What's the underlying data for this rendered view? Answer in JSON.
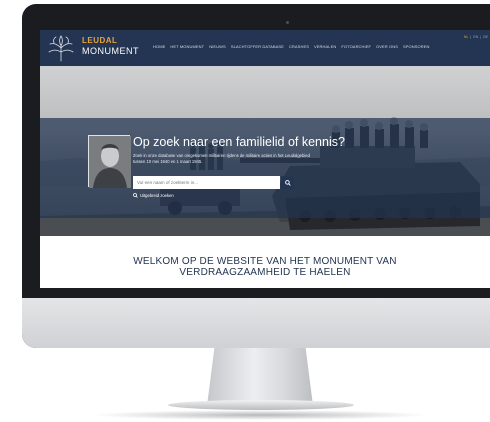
{
  "logo": {
    "line1": "LEUDAL",
    "line2": "MONUMENT"
  },
  "nav": {
    "items": [
      "HOME",
      "HET MONUMENT",
      "NIEUWS",
      "SLACHTOFFER DATABASE",
      "CRASHES",
      "VERHALEN",
      "FOTOARCHIEF",
      "OVER ONS",
      "SPONSOREN"
    ]
  },
  "languages": {
    "nl": "NL",
    "en": "EN",
    "de": "DE"
  },
  "hero": {
    "title": "Op zoek naar een familielid of kennis?",
    "subtitle": "Zoek in onze database van omgekomen militairen tijdens de militaire acties in het Leudalgebied tussen 10 mei 1940 en 1 maart 1945.",
    "search_placeholder": "Vul een naam of zoekterm in...",
    "advanced_search": "Uitgebreid zoeken"
  },
  "welcome": {
    "line1": "WELKOM OP DE WEBSITE VAN HET MONUMENT VAN",
    "line2": "VERDRAAGZAAMHEID TE HAELEN"
  },
  "colors": {
    "header_bg": "#233552",
    "logo_accent": "#e6a23c",
    "welcome_text": "#233552"
  },
  "icons": [
    "tree-logo-icon",
    "search-icon"
  ]
}
